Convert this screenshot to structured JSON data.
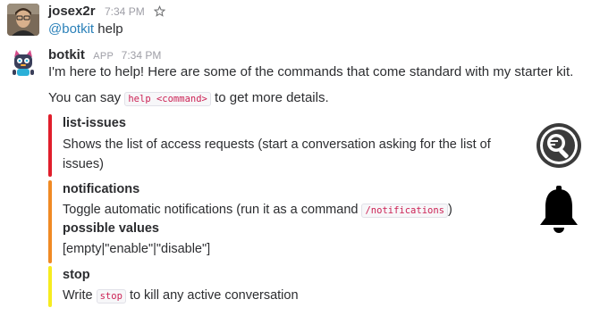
{
  "messages": [
    {
      "user": "josex2r",
      "time": "7:34 PM",
      "star_icon": "star-icon",
      "mention": "@botkit",
      "text": "help"
    },
    {
      "user": "botkit",
      "badge": "APP",
      "time": "7:34 PM",
      "intro": "I'm here to help! Here are some of the commands that come standard with my starter kit.",
      "hint_before": "You can say",
      "hint_code": "help <command>",
      "hint_after": "to get more details."
    }
  ],
  "attachments": [
    {
      "color": "#e01e2b",
      "title": "list-issues",
      "text_line1": "Shows the list of access requests (start a conversation asking for the list of",
      "text_line2": "issues)",
      "thumb_icon": "search-ticket-icon"
    },
    {
      "color": "#f08a24",
      "title": "notifications",
      "text_before": "Toggle automatic notifications (run it as a command",
      "text_code": "/notifications",
      "text_after": ")",
      "sub_title": "possible values",
      "sub_text": "[empty|\"enable\"|\"disable\"]",
      "thumb_icon": "bell-icon"
    },
    {
      "color": "#f6ec20",
      "title": "stop",
      "text_before": "Write",
      "text_code": "stop",
      "text_after": "to kill any active conversation"
    }
  ]
}
